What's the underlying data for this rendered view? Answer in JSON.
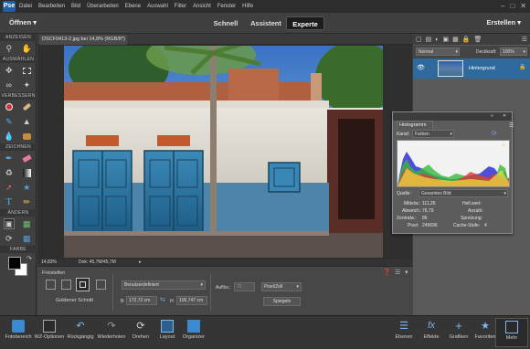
{
  "menubar": {
    "logo": "Pse",
    "items": [
      "Datei",
      "Bearbeiten",
      "Bild",
      "Überarbeiten",
      "Ebene",
      "Auswahl",
      "Filter",
      "Ansicht",
      "Fenster",
      "Hilfe"
    ]
  },
  "modebar": {
    "open_label": "Öffnen",
    "tabs": [
      "Schnell",
      "Assistent",
      "Experte"
    ],
    "active_tab": "Experte",
    "create_label": "Erstellen"
  },
  "toolbox": {
    "sections": [
      "ANZEIGEN",
      "AUSWÄHLEN",
      "VERBESSERN",
      "ZEICHNEN",
      "ÄNDERN",
      "FARBE"
    ]
  },
  "document": {
    "tab_label": "DSCF0413-2.jpg bei 14,8% (RGB/8*)",
    "zoom": "14,83%",
    "doc_size": "Dok: 45,7M/45,7M"
  },
  "layers": {
    "blend_mode": "Normal",
    "opacity_label": "Deckkraft:",
    "opacity_value": "100%",
    "layer_name": "Hintergrund"
  },
  "histogram": {
    "title": "Histogramm",
    "channel_label": "Kanal:",
    "channel_value": "Farben",
    "source_label": "Quelle:",
    "source_value": "Gesamtes Bild",
    "stats_left": [
      {
        "label": "Mittelw.:",
        "value": "111,26"
      },
      {
        "label": "Abweich.:",
        "value": "76,79"
      },
      {
        "label": "Zentralw.:",
        "value": "86"
      },
      {
        "label": "Pixel:",
        "value": "249696"
      }
    ],
    "stats_right": [
      {
        "label": "Hell.wert:",
        "value": ""
      },
      {
        "label": "Anzahl:",
        "value": ""
      },
      {
        "label": "Spreizung:",
        "value": ""
      },
      {
        "label": "Cache-Stufe:",
        "value": "4"
      }
    ]
  },
  "options": {
    "tool_name": "Freistellen",
    "preset_caption": "Goldener Schnitt",
    "preset_value": "Benutzerdefiniert",
    "width_label": "B:",
    "width_value": "172,72 cm",
    "height_label": "H:",
    "height_value": "106,747 cm",
    "resolution_label": "Auflös.:",
    "resolution_value": "72",
    "unit_value": "Pixel/Zoll",
    "mirror_label": "Spiegeln"
  },
  "taskbar": {
    "left": [
      "Fotobereich",
      "WZ-Optionen",
      "Rückgängig",
      "Wiederholen",
      "Drehen",
      "Layout",
      "Organizer"
    ],
    "right": [
      "Ebenen",
      "Effekte",
      "Grafiken",
      "Favoriten",
      "Mehr"
    ]
  },
  "colors": {
    "accent": "#2f6a9e",
    "door_blue": "#2a7fa8"
  }
}
